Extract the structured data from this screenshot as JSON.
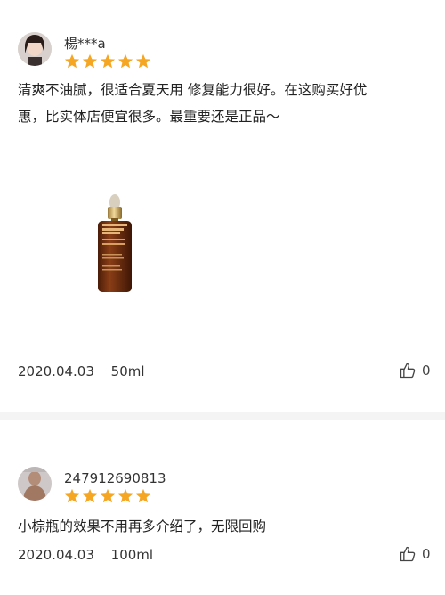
{
  "reviews": [
    {
      "username": "楊***a",
      "rating": 5,
      "text_line1": "清爽不油腻，很适合夏天用 修复能力很好。在这购买好优",
      "text_line2": "惠，比实体店便宜很多。最重要还是正品～",
      "date": "2020.04.03",
      "size": "50ml",
      "likes": "0",
      "product_label": "ESTEE LAUDER Advanced Night Repair"
    },
    {
      "username": "247912690813",
      "rating": 5,
      "text_line1": "小棕瓶的效果不用再多介绍了，无限回购",
      "date": "2020.04.03",
      "size": "100ml",
      "likes": "0"
    }
  ],
  "icons": {
    "star": "star-icon",
    "like": "thumbs-up-icon"
  },
  "colors": {
    "star": "#f5a623",
    "bottle": "#6b2d12"
  }
}
